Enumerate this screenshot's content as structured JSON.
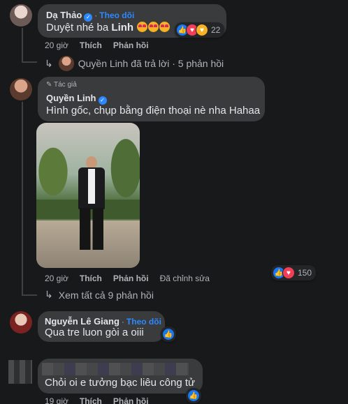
{
  "comments": [
    {
      "author": "Dạ Thảo",
      "follow": "Theo dõi",
      "text": "Duyệt nhé ba ",
      "mention": "Linh",
      "reactions_count": "22",
      "time": "20 giờ",
      "like": "Thích",
      "reply": "Phản hồi",
      "replies_summary": "Quyền Linh đã trả lời · 5 phản hồi"
    },
    {
      "author_badge": "Tác giả",
      "author": "Quyền Linh",
      "text": "Hình gốc, chụp bằng điện thoại nè nha Hahaa",
      "reactions_count": "150",
      "time": "20 giờ",
      "like": "Thích",
      "reply": "Phản hồi",
      "edited": "Đã chỉnh sửa",
      "view_all": "Xem tất cả 9 phản hồi"
    },
    {
      "author": "Nguyễn Lê Giang",
      "follow": "Theo dõi",
      "text": "Qua tre luon gòi a oiii"
    },
    {
      "text": "Chỏi oi e tưởng bạc liêu công tử",
      "time": "19 giờ",
      "like": "Thích",
      "reply": "Phản hồi"
    }
  ],
  "colors": {
    "background": "#18191a",
    "bubble": "#3a3b3c",
    "link": "#2d88ff",
    "like": "#1877f2",
    "love": "#f33e58"
  },
  "icons": [
    "verified-badge-icon",
    "like-reaction-icon",
    "love-reaction-icon",
    "care-reaction-icon",
    "reply-arrow-icon",
    "pencil-icon"
  ]
}
